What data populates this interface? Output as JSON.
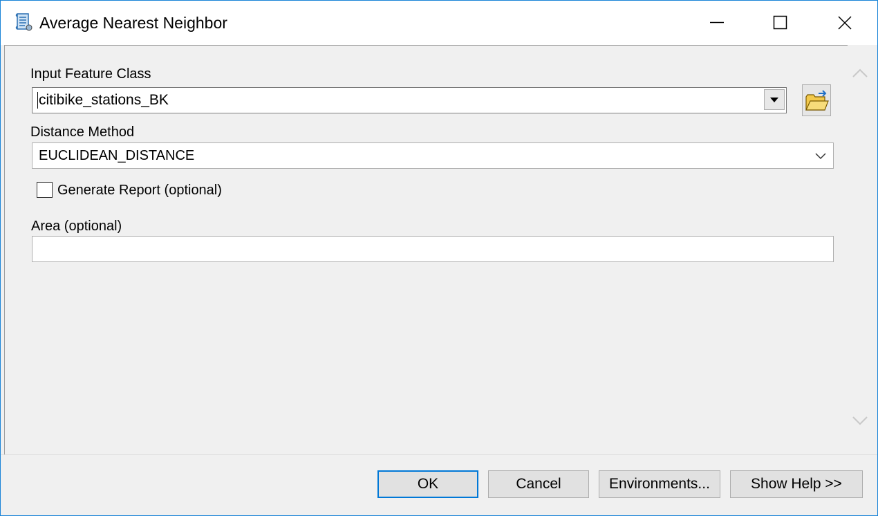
{
  "window": {
    "title": "Average Nearest Neighbor"
  },
  "form": {
    "input_feature_class": {
      "label": "Input Feature Class",
      "value": "citibike_stations_BK"
    },
    "distance_method": {
      "label": "Distance Method",
      "value": "EUCLIDEAN_DISTANCE"
    },
    "generate_report": {
      "label": "Generate Report (optional)",
      "checked": false
    },
    "area": {
      "label": "Area (optional)",
      "value": ""
    }
  },
  "buttons": {
    "ok": "OK",
    "cancel": "Cancel",
    "environments": "Environments...",
    "show_help": "Show Help >>"
  },
  "colors": {
    "accent": "#0078d7",
    "window_border": "#1883d7",
    "folder": "#f2c94c"
  },
  "icons": {
    "app": "toolscript-icon",
    "minimize": "minimize-icon",
    "maximize": "maximize-icon",
    "close": "close-icon",
    "browse": "open-folder-icon",
    "dropdown": "chevron-down-icon"
  }
}
